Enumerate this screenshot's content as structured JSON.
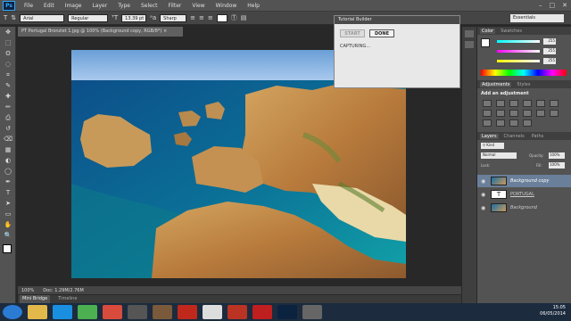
{
  "app": {
    "logo": "Ps"
  },
  "menu": [
    "File",
    "Edit",
    "Image",
    "Layer",
    "Type",
    "Select",
    "Filter",
    "View",
    "Window",
    "Help"
  ],
  "window_controls": {
    "minimize": "–",
    "maximize": "□",
    "close": "✕"
  },
  "options": {
    "tool_icon": "T",
    "font_family": "Arial",
    "font_style": "Regular",
    "font_size": "13.39 pt",
    "antialias": "Sharp",
    "workspace": "Essentials"
  },
  "toolbar_icons": [
    "move-icon",
    "marquee-icon",
    "lasso-icon",
    "quick-select-icon",
    "crop-icon",
    "eyedropper-icon",
    "healing-icon",
    "brush-icon",
    "clone-stamp-icon",
    "history-brush-icon",
    "eraser-icon",
    "gradient-icon",
    "blur-icon",
    "dodge-icon",
    "pen-icon",
    "type-icon",
    "path-select-icon",
    "shape-icon",
    "hand-icon",
    "zoom-icon"
  ],
  "toolbar_glyphs": [
    "✥",
    "⬚",
    "ʘ",
    "◌",
    "⌗",
    "✎",
    "✚",
    "✏",
    "⎙",
    "↺",
    "⌫",
    "▦",
    "◐",
    "◯",
    "✒",
    "T",
    "➤",
    "▭",
    "✋",
    "🔍"
  ],
  "document": {
    "tab": "PT Portugal Bronziet 1.jpg @ 100% (Background copy, RGB/8*) ×",
    "zoom": "100%",
    "doc_size": "Doc: 1.29M/2.76M"
  },
  "bottom_tabs": [
    "Mini Bridge",
    "Timeline"
  ],
  "tutorial_builder": {
    "title": "Tutorial Builder",
    "start_label": "START",
    "done_label": "DONE",
    "status": "CAPTURING..."
  },
  "color_panel": {
    "tabs": [
      "Color",
      "Swatches"
    ],
    "r": "255",
    "g": "255",
    "b": "255"
  },
  "adjustments_panel": {
    "tabs": [
      "Adjustments",
      "Styles"
    ],
    "heading": "Add an adjustment"
  },
  "layers_panel": {
    "tabs": [
      "Layers",
      "Channels",
      "Paths"
    ],
    "kind": "Kind",
    "blend": "Normal",
    "opacity_label": "Opacity:",
    "opacity": "100%",
    "lock_label": "Lock:",
    "fill_label": "Fill:",
    "fill": "100%",
    "layers": [
      {
        "name": "Background copy",
        "type": "image",
        "selected": true
      },
      {
        "name": "PORTUGAL",
        "type": "text",
        "selected": false
      },
      {
        "name": "Background",
        "type": "image",
        "selected": false
      }
    ]
  },
  "taskbar": {
    "apps": [
      "start-orb",
      "explorer",
      "ie",
      "chrome",
      "ccleaner",
      "winamp",
      "files",
      "opera",
      "media",
      "pdf",
      "filezilla",
      "photoshop",
      "other"
    ],
    "time": "15:05",
    "date": "06/05/2014"
  },
  "colors": {
    "accent": "#31a8ff",
    "panel": "#535353",
    "canvas_bg": "#282828"
  }
}
